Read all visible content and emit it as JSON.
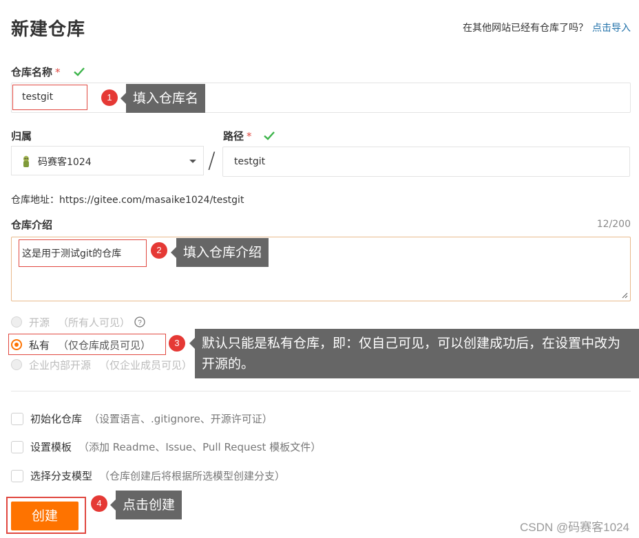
{
  "header": {
    "title": "新建仓库",
    "import_hint": "在其他网站已经有仓库了吗？",
    "import_link": "点击导入"
  },
  "repo_name": {
    "label": "仓库名称",
    "required_mark": "*",
    "value": "testgit"
  },
  "owner": {
    "label": "归属",
    "selected": "码赛客1024"
  },
  "path": {
    "label": "路径",
    "required_mark": "*",
    "separator": "/",
    "value": "testgit"
  },
  "repo_url": {
    "text": "仓库地址：https://gitee.com/masaike1024/testgit"
  },
  "intro": {
    "label": "仓库介绍",
    "counter": "12/200",
    "value": "这是用于测试git的仓库"
  },
  "visibility": {
    "options": [
      {
        "label": "开源",
        "sub": "（所有人可见）",
        "checked": false,
        "disabled": true
      },
      {
        "label": "私有",
        "sub": "（仅仓库成员可见）",
        "checked": true,
        "disabled": false
      },
      {
        "label": "企业内部开源",
        "sub": "（仅企业成员可见）",
        "checked": false,
        "disabled": true
      }
    ]
  },
  "options": [
    {
      "label": "初始化仓库",
      "sub": "（设置语言、.gitignore、开源许可证）"
    },
    {
      "label": "设置模板",
      "sub": "（添加 Readme、Issue、Pull Request 模板文件）"
    },
    {
      "label": "选择分支模型",
      "sub": "（仓库创建后将根据所选模型创建分支）"
    }
  ],
  "create_button": "创建",
  "annotations": [
    {
      "num": "1",
      "text": "填入仓库名"
    },
    {
      "num": "2",
      "text": "填入仓库介绍"
    },
    {
      "num": "3",
      "text": "默认只能是私有仓库，即：仅自己可见，可以创建成功后，在设置中改为开源的。"
    },
    {
      "num": "4",
      "text": "点击创建"
    }
  ],
  "watermark": "CSDN @码赛客1024",
  "colors": {
    "accent": "#fe7300",
    "link": "#1e6fa8",
    "required": "#e0463e",
    "valid_check": "#3cb44a",
    "callout_bg": "#666666",
    "callout_badge": "#e53935"
  }
}
